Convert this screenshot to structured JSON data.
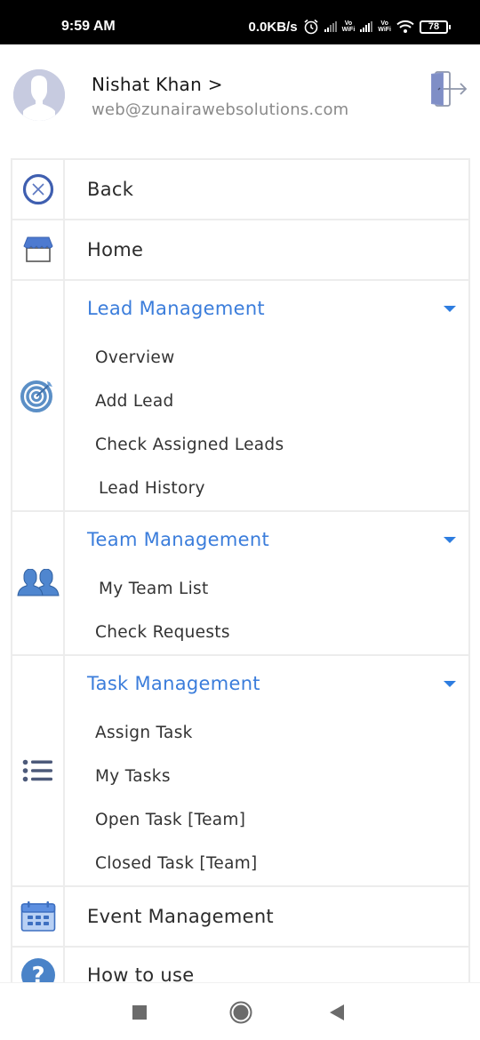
{
  "status_bar": {
    "time": "9:59 AM",
    "net_speed": "0.0KB/s",
    "vowifi_label_top": "Vo",
    "vowifi_label_bottom": "WiFi",
    "battery": "78"
  },
  "header": {
    "user_name": "Nishat Khan >",
    "user_email": "web@zunairawebsolutions.com",
    "avatar_icon": "default-user-avatar",
    "logout_icon": "logout-door-icon"
  },
  "menu": {
    "back": {
      "label": "Back",
      "icon": "close-circle-icon"
    },
    "home": {
      "label": "Home",
      "icon": "store-icon"
    },
    "lead_management": {
      "label": "Lead Management",
      "icon": "target-icon",
      "expanded": true,
      "items": [
        "Overview",
        "Add Lead",
        "Check Assigned Leads",
        "Lead History"
      ]
    },
    "team_management": {
      "label": "Team Management",
      "icon": "users-icon",
      "expanded": true,
      "items": [
        "My Team List",
        "Check Requests"
      ]
    },
    "task_management": {
      "label": "Task Management",
      "icon": "list-icon",
      "expanded": true,
      "items": [
        "Assign Task",
        "My Tasks",
        "Open Task [Team]",
        "Closed Task [Team]"
      ]
    },
    "event_management": {
      "label": "Event Management",
      "icon": "calendar-icon"
    },
    "how_to_use": {
      "label": "How to use",
      "icon": "help-icon"
    }
  },
  "colors": {
    "accent": "#3b7ddb",
    "icon_blue": "#4a7fc8",
    "divider": "#ececec",
    "text": "#2b2b2b",
    "email_text": "#8a8a8a"
  },
  "nav_bar": {
    "recent_icon": "square-icon",
    "home_icon": "circle-icon",
    "back_icon": "triangle-back-icon"
  }
}
